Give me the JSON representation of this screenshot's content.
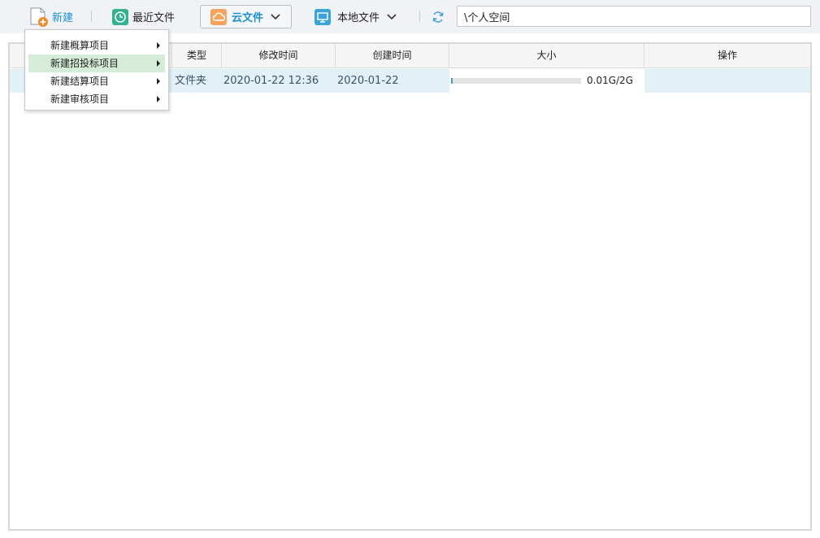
{
  "toolbar": {
    "new_label": "新建",
    "recent_label": "最近文件",
    "cloud_label": "云文件",
    "local_label": "本地文件",
    "path_value": "\\个人空间"
  },
  "new_menu": {
    "items": [
      {
        "label": "新建概算项目",
        "active": false
      },
      {
        "label": "新建招投标项目",
        "active": true
      },
      {
        "label": "新建结算项目",
        "active": false
      },
      {
        "label": "新建审核项目",
        "active": false
      }
    ]
  },
  "table": {
    "columns": [
      "",
      "类型",
      "修改时间",
      "创建时间",
      "大小",
      "操作"
    ],
    "rows": [
      {
        "type": "文件夹",
        "modified": "2020-01-22 12:36",
        "created": "2020-01-22",
        "size": "0.01G/2G",
        "usage_fraction": 0.005
      }
    ]
  },
  "icons": {
    "new": "new-file-plus-icon",
    "recent": "clock-icon",
    "cloud": "cloud-icon",
    "local": "monitor-icon",
    "refresh": "refresh-icon"
  },
  "colors": {
    "accent": "#1a8fd6",
    "new_plus": "#f08a24",
    "recent_icon": "#35b18f",
    "cloud_icon": "#f4a460",
    "local_icon": "#3aa3d8",
    "row_highlight": "#e2f1f7",
    "menu_highlight": "#d4ecd8"
  }
}
